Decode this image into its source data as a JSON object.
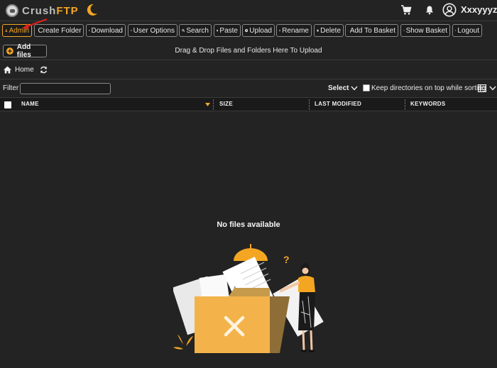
{
  "header": {
    "brand_part1": "Crush",
    "brand_part2": "FTP",
    "username": "Xxxyyyzzz",
    "icons": [
      "logo-icon",
      "moon-icon",
      "cart-icon",
      "bell-icon",
      "user-circle-icon"
    ]
  },
  "toolbar": {
    "admin": "Admin",
    "create_folder": "Create Folder",
    "download": "Download",
    "user_options": "User Options",
    "search": "Search",
    "paste": "Paste",
    "upload": "Upload",
    "rename": "Rename",
    "delete": "Delete",
    "add_to_basket": "Add To Basket",
    "show_basket": "Show Basket",
    "logout": "Logout"
  },
  "upload": {
    "add_files": "Add files",
    "drop_hint": "Drag & Drop Files and Folders Here To Upload"
  },
  "breadcrumb": {
    "home": "Home"
  },
  "filter": {
    "label": "Filter",
    "value": "",
    "select_label": "Select",
    "keep_dirs_label": "Keep directories on top while sorting",
    "keep_dirs_checked": false
  },
  "table": {
    "columns": [
      "NAME",
      "SIZE",
      "LAST MODIFIED",
      "KEYWORDS"
    ],
    "sort_column": "NAME",
    "rows": []
  },
  "empty_state": {
    "message": "No files available"
  },
  "colors": {
    "background": "#232323",
    "accent": "#f4a623",
    "text": "#e8e8e8",
    "annotation_arrow": "#e0201a"
  }
}
